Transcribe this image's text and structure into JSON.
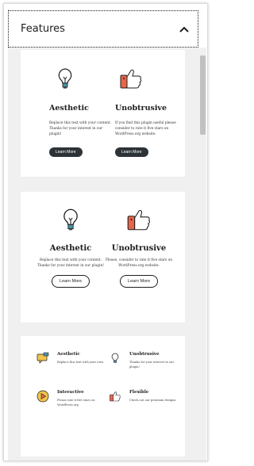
{
  "panel": {
    "title": "Features"
  },
  "colors": {
    "accent_orange": "#e8654a",
    "accent_yellow": "#f0c44c",
    "dark_button": "#2c3338"
  },
  "card1": {
    "items": [
      {
        "icon": "lightbulb-icon",
        "title": "Aesthetic",
        "text": "Replace this text with your content. Thanks for your interest in our plugin!",
        "button": "Learn More"
      },
      {
        "icon": "thumbs-up-icon",
        "title": "Unobtrusive",
        "text": "If you find this plugin useful please consider to rate it five stars on WordPress.org website.",
        "button": "Learn More"
      }
    ]
  },
  "card2": {
    "items": [
      {
        "icon": "lightbulb-icon",
        "title": "Aesthetic",
        "text": "Replace this text with your content. Thanks for your interest in our plugin!",
        "button": "Learn More"
      },
      {
        "icon": "thumbs-up-icon",
        "title": "Unobtrusive",
        "text": "Please, consider to rate it five stars on WordPress.org website.",
        "button": "Learn More"
      }
    ]
  },
  "card3": {
    "items": [
      {
        "icon": "chat-bubble-icon",
        "title": "Aesthetic",
        "text": "Replace this text with your own."
      },
      {
        "icon": "lightbulb-icon",
        "title": "Unobtrusive",
        "text": "Thanks for your interest in our plugin!"
      },
      {
        "icon": "play-circle-icon",
        "title": "Interactive",
        "text": "Please rate it five stars on WordPress.org"
      },
      {
        "icon": "thumbs-up-icon",
        "title": "Flexible",
        "text": "Check out our premium designs."
      }
    ]
  }
}
